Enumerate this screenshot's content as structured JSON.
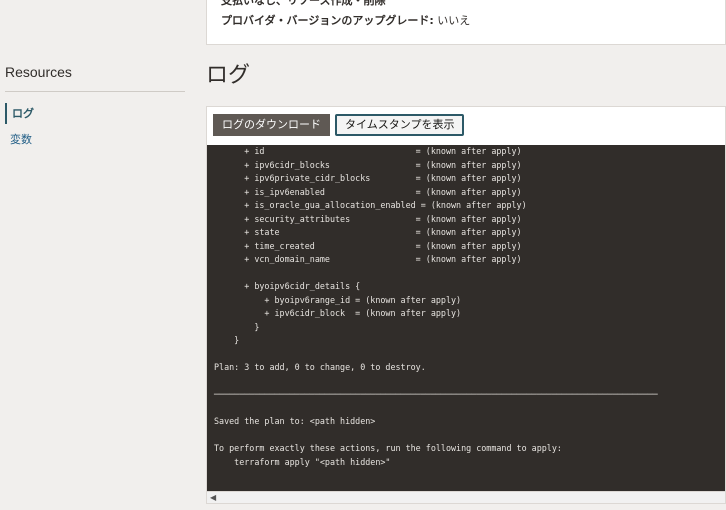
{
  "details": {
    "line1": "支払いなし、リソース作成・削除",
    "upgrade_label": "プロバイダ・バージョンのアップグレード:",
    "upgrade_value": " いいえ"
  },
  "sidebar": {
    "title": "Resources",
    "items": [
      {
        "label": "ログ",
        "active": true
      },
      {
        "label": "変数",
        "active": false
      }
    ]
  },
  "main": {
    "title": "ログ",
    "download_button": "ログのダウンロード",
    "timestamp_button": "タイムスタンプを表示"
  },
  "log_lines": [
    "      + id                              = (known after apply)",
    "      + ipv6cidr_blocks                 = (known after apply)",
    "      + ipv6private_cidr_blocks         = (known after apply)",
    "      + is_ipv6enabled                  = (known after apply)",
    "      + is_oracle_gua_allocation_enabled = (known after apply)",
    "      + security_attributes             = (known after apply)",
    "      + state                           = (known after apply)",
    "      + time_created                    = (known after apply)",
    "      + vcn_domain_name                 = (known after apply)",
    "",
    "      + byoipv6cidr_details {",
    "          + byoipv6range_id = (known after apply)",
    "          + ipv6cidr_block  = (known after apply)",
    "        }",
    "    }",
    "",
    "Plan: 3 to add, 0 to change, 0 to destroy.",
    "",
    "────────────────────────────────────────────────────────────────────────────────────────",
    "",
    "Saved the plan to: <path hidden>",
    "",
    "To perform exactly these actions, run the following command to apply:",
    "    terraform apply \"<path hidden>\""
  ]
}
